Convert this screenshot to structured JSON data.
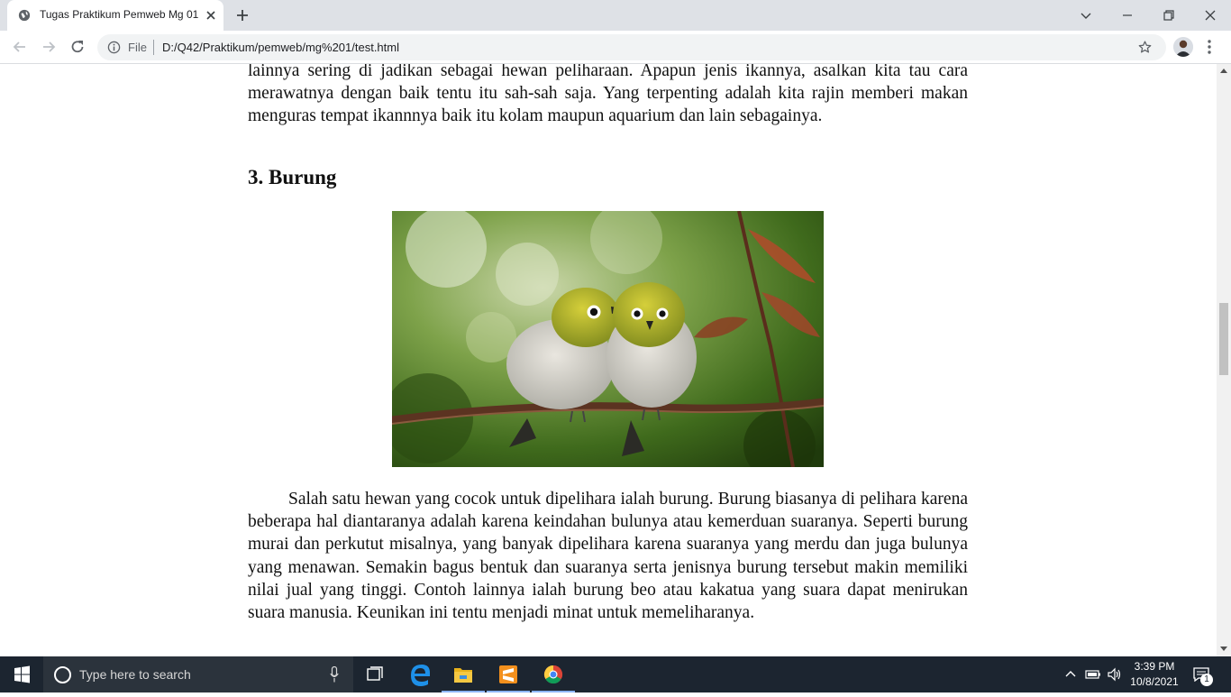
{
  "browser": {
    "tab_title": "Tugas Praktikum Pemweb Mg 01",
    "file_label": "File",
    "url": "D:/Q42/Praktikum/pemweb/mg%201/test.html",
    "window_controls": [
      "chevron-down-icon",
      "minimize-icon",
      "restore-icon",
      "close-icon"
    ]
  },
  "article": {
    "paragraph_1": "lainnya sering di jadikan sebagai hewan peliharaan. Apapun jenis ikannya, asalkan kita tau cara merawatnya dengan baik tentu itu sah-sah saja. Yang terpenting adalah kita rajin memberi makan menguras tempat ikannnya baik itu kolam maupun aquarium dan lain sebagainya.",
    "heading": "3. Burung",
    "paragraph_2": "Salah satu hewan yang cocok untuk dipelihara ialah burung. Burung biasanya di pelihara karena beberapa hal diantaranya adalah karena keindahan bulunya atau kemerduan suaranya. Seperti burung murai dan perkutut misalnya, yang banyak dipelihara karena suaranya yang merdu dan juga bulunya yang menawan. Semakin bagus bentuk dan suaranya serta jenisnya burung tersebut makin memiliki nilai jual yang tinggi. Contoh lainnya ialah burung beo atau kakatua yang suara dapat menirukan suara manusia. Keunikan ini tentu menjadi minat untuk memeliharanya."
  },
  "taskbar": {
    "search_placeholder": "Type here to search",
    "time": "3:39 PM",
    "date": "10/8/2021",
    "notification_count": "1",
    "pinned": [
      "task-view-icon",
      "edge-icon",
      "file-explorer-icon",
      "sublime-text-icon",
      "chrome-icon"
    ]
  }
}
